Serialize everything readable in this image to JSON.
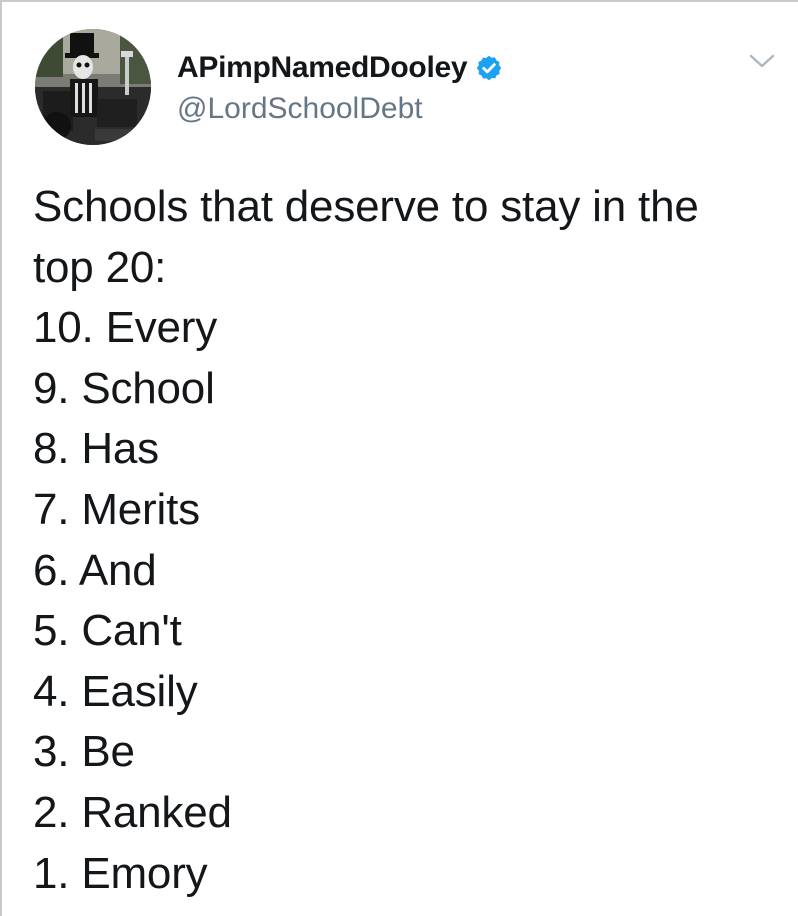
{
  "tweet": {
    "display_name": "APimpNamedDooley",
    "handle": "@LordSchoolDebt",
    "verified": true,
    "icons": {
      "avatar": "avatar-photo",
      "verified": "verified-badge-icon",
      "menu": "chevron-down-icon"
    },
    "colors": {
      "text": "#14171a",
      "handle": "#657786",
      "verified_badge": "#1da1f2",
      "caret": "#aab8c2"
    },
    "body": {
      "lines": [
        "Schools that deserve to stay in the",
        "top 20:",
        "10. Every",
        "9. School",
        "8. Has",
        "7. Merits",
        "6. And",
        "5. Can't",
        "4. Easily",
        "3. Be",
        "2. Ranked",
        "1. Emory"
      ]
    }
  }
}
